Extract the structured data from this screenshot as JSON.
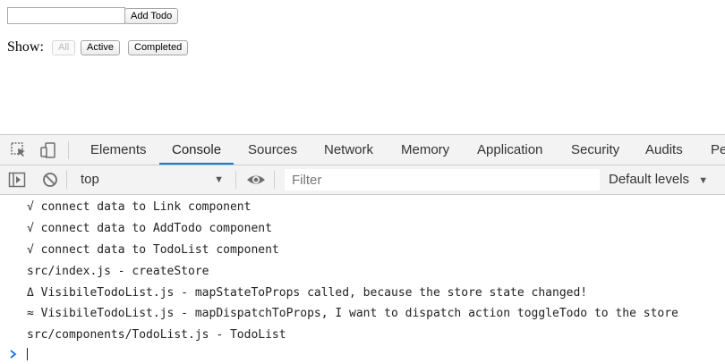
{
  "app": {
    "input": {
      "value": "",
      "placeholder": ""
    },
    "add_button_label": "Add Todo",
    "show_label": "Show:",
    "filters": [
      "All",
      "Active",
      "Completed"
    ],
    "active_filter": "All"
  },
  "devtools": {
    "tabs": [
      "Elements",
      "Console",
      "Sources",
      "Network",
      "Memory",
      "Application",
      "Security",
      "Audits",
      "Pe"
    ],
    "active_tab": "Console",
    "toolbar": {
      "context": "top",
      "filter_placeholder": "Filter",
      "levels_label": "Default levels"
    },
    "console_lines": [
      "√ connect data to Link component",
      "√ connect data to AddTodo component",
      "√ connect data to TodoList component",
      "src/index.js - createStore",
      "Δ VisibileTodoList.js - mapStateToProps called, because the store state changed!",
      "≈ VisibileTodoList.js - mapDispatchToProps, I want to dispatch action toggleTodo to the store",
      "src/components/TodoList.js - TodoList"
    ],
    "prompt_value": ""
  },
  "colors": {
    "accent": "#1a73e8",
    "panel_bg": "#f3f3f3",
    "border": "#cbcbcb"
  },
  "icons": [
    "inspect-element-icon",
    "device-toggle-icon",
    "sidebar-toggle-icon",
    "clear-console-icon",
    "eye-icon",
    "chevron-down-icon",
    "prompt-chevron-icon"
  ]
}
